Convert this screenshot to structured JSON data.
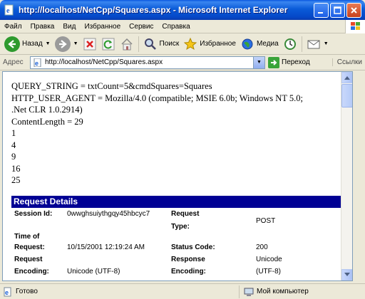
{
  "window": {
    "title": "http://localhost/NetCpp/Squares.aspx - Microsoft Internet Explorer"
  },
  "menu": [
    "Файл",
    "Правка",
    "Вид",
    "Избранное",
    "Сервис",
    "Справка"
  ],
  "toolbar": {
    "back_label": "Назад",
    "search_label": "Поиск",
    "favorites_label": "Избранное",
    "media_label": "Медиа"
  },
  "address": {
    "label": "Адрес",
    "url": "http://localhost/NetCpp/Squares.aspx",
    "go_label": "Переход",
    "links_label": "Ссылки"
  },
  "page": {
    "output_lines": [
      "QUERY_STRING = txtCount=5&cmdSquares=Squares",
      "HTTP_USER_AGENT = Mozilla/4.0 (compatible; MSIE 6.0b; Windows NT 5.0;",
      ".Net CLR 1.0.2914)",
      "ContentLength = 29",
      "1",
      "4",
      "9",
      "16",
      "25"
    ],
    "request_details": {
      "heading": "Request Details",
      "session_id_label": "Session Id:",
      "session_id_value": "0wwghsuiythgqy45hbcyc7",
      "request_type_label_1": "Request",
      "request_type_label_2": "Type:",
      "request_type_value": "POST",
      "time_label_1": "Time of",
      "time_label_2": "Request:",
      "time_value": "10/15/2001 12:19:24 AM",
      "status_code_label": "Status Code:",
      "status_code_value": "200",
      "request_encoding_label_1": "Request",
      "request_encoding_label_2": "Encoding:",
      "request_encoding_value": "Unicode (UTF-8)",
      "response_encoding_label_1": "Response",
      "response_encoding_label_2": "Encoding:",
      "response_encoding_value_1": "Unicode",
      "response_encoding_value_2": "(UTF-8)"
    }
  },
  "status": {
    "left_text": "Готово",
    "zone_text": "Мой компьютер"
  }
}
